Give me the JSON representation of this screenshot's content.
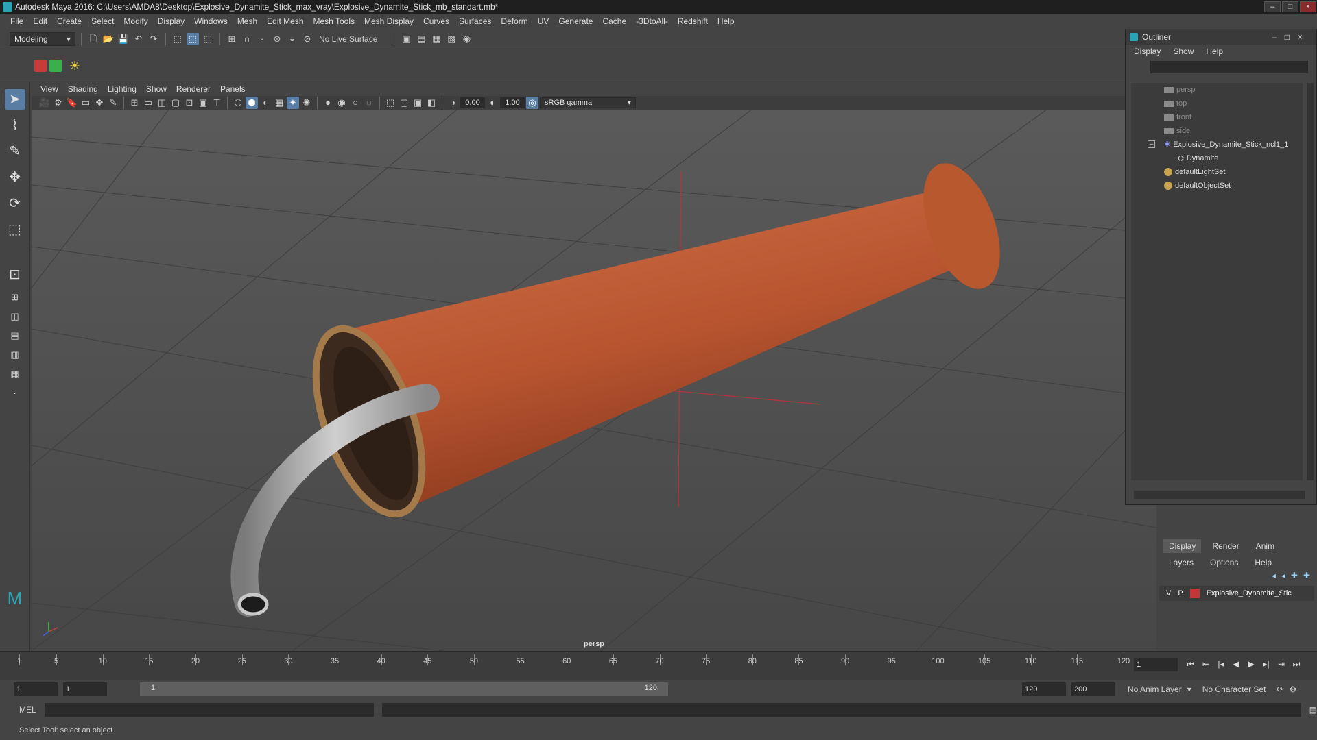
{
  "app": {
    "title": "Autodesk Maya 2016: C:\\Users\\AMDA8\\Desktop\\Explosive_Dynamite_Stick_max_vray\\Explosive_Dynamite_Stick_mb_standart.mb*"
  },
  "menubar": [
    "File",
    "Edit",
    "Create",
    "Select",
    "Modify",
    "Display",
    "Windows",
    "Mesh",
    "Edit Mesh",
    "Mesh Tools",
    "Mesh Display",
    "Curves",
    "Surfaces",
    "Deform",
    "UV",
    "Generate",
    "Cache",
    "-3DtoAll-",
    "Redshift",
    "Help"
  ],
  "toolbar": {
    "mode": "Modeling",
    "live_surface": "No Live Surface"
  },
  "panel": {
    "menus": [
      "View",
      "Shading",
      "Lighting",
      "Show",
      "Renderer",
      "Panels"
    ],
    "exposure": "0.00",
    "gamma": "1.00",
    "colorspace": "sRGB gamma",
    "camera_label": "persp"
  },
  "outliner": {
    "title": "Outliner",
    "menus": [
      "Display",
      "Show",
      "Help"
    ],
    "items": [
      {
        "label": "persp",
        "kind": "camera",
        "dim": true,
        "indent": 0
      },
      {
        "label": "top",
        "kind": "camera",
        "dim": true,
        "indent": 0
      },
      {
        "label": "front",
        "kind": "camera",
        "dim": true,
        "indent": 0
      },
      {
        "label": "side",
        "kind": "camera",
        "dim": true,
        "indent": 0
      },
      {
        "label": "Explosive_Dynamite_Stick_ncl1_1",
        "kind": "group",
        "dim": false,
        "indent": 0
      },
      {
        "label": "Dynamite",
        "kind": "mesh",
        "dim": false,
        "indent": 1
      },
      {
        "label": "defaultLightSet",
        "kind": "set",
        "dim": false,
        "indent": 0
      },
      {
        "label": "defaultObjectSet",
        "kind": "set",
        "dim": false,
        "indent": 0
      }
    ]
  },
  "channelbox": {
    "tabs": [
      "Display",
      "Render",
      "Anim"
    ],
    "submenus": [
      "Layers",
      "Options",
      "Help"
    ],
    "layer": {
      "v": "V",
      "p": "P",
      "name": "Explosive_Dynamite_Stic",
      "color": "#c23838"
    }
  },
  "timeline": {
    "ticks": [
      1,
      5,
      10,
      15,
      20,
      25,
      30,
      35,
      40,
      45,
      50,
      55,
      60,
      65,
      70,
      75,
      80,
      85,
      90,
      95,
      100,
      105,
      110,
      115,
      120
    ],
    "current_frame": "1"
  },
  "range": {
    "start": "1",
    "playback_start": "1",
    "slider_start": "1",
    "slider_end": "120",
    "playback_end": "120",
    "end": "200",
    "anim_layer": "No Anim Layer",
    "character_set": "No Character Set"
  },
  "cmd": {
    "label": "MEL"
  },
  "status": {
    "help": "Select Tool: select an object"
  }
}
